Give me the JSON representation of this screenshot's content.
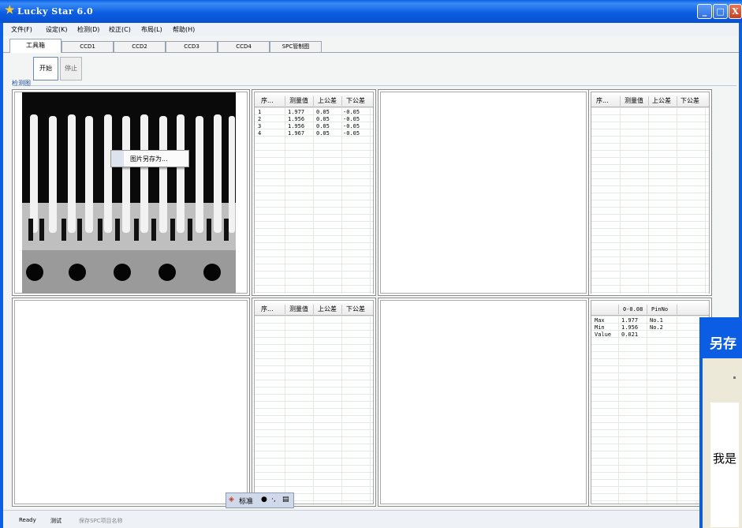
{
  "window": {
    "title": "Lucky Star 6.0",
    "controls": [
      "_",
      "□",
      "X"
    ]
  },
  "menu": [
    "文件(F)",
    "设定(K)",
    "检测(D)",
    "校正(C)",
    "布局(L)",
    "帮助(H)"
  ],
  "tabs": [
    "工具箱",
    "CCD1",
    "CCD2",
    "CCD3",
    "CCD4",
    "SPC管制图"
  ],
  "toolbar": {
    "start": "开始",
    "stop": "停止"
  },
  "group_label": "检测图",
  "context_menu": {
    "item": "图片另存为..."
  },
  "table1": {
    "headers": [
      "序...",
      "测量值",
      "上公差",
      "下公差"
    ],
    "rows": [
      [
        "1",
        "1.977",
        "0.05",
        "-0.05"
      ],
      [
        "2",
        "1.956",
        "0.05",
        "-0.05"
      ],
      [
        "3",
        "1.956",
        "0.05",
        "-0.05"
      ],
      [
        "4",
        "1.967",
        "0.05",
        "-0.05"
      ]
    ]
  },
  "table2": {
    "headers": [
      "序...",
      "测量值",
      "上公差",
      "下公差"
    ]
  },
  "table3": {
    "headers": [
      "序...",
      "测量值",
      "上公差",
      "下公差"
    ]
  },
  "table4": {
    "headers": [
      "",
      "0-0.08",
      "PinNo"
    ],
    "rows": [
      [
        "Max",
        "1.977",
        "No.1"
      ],
      [
        "Min",
        "1.956",
        "No.2"
      ],
      [
        "Value",
        "0.021",
        ""
      ]
    ]
  },
  "status": {
    "ready": "Ready",
    "test": "测试",
    "spc": "保存SPC项目名称"
  },
  "ime": {
    "label": "标准"
  },
  "dialog": {
    "title": "另存",
    "text": "我是"
  },
  "colors": {
    "titlebar": "#0d5ee3",
    "background": "#f3f5f4",
    "accent": "#1a4aa0"
  }
}
